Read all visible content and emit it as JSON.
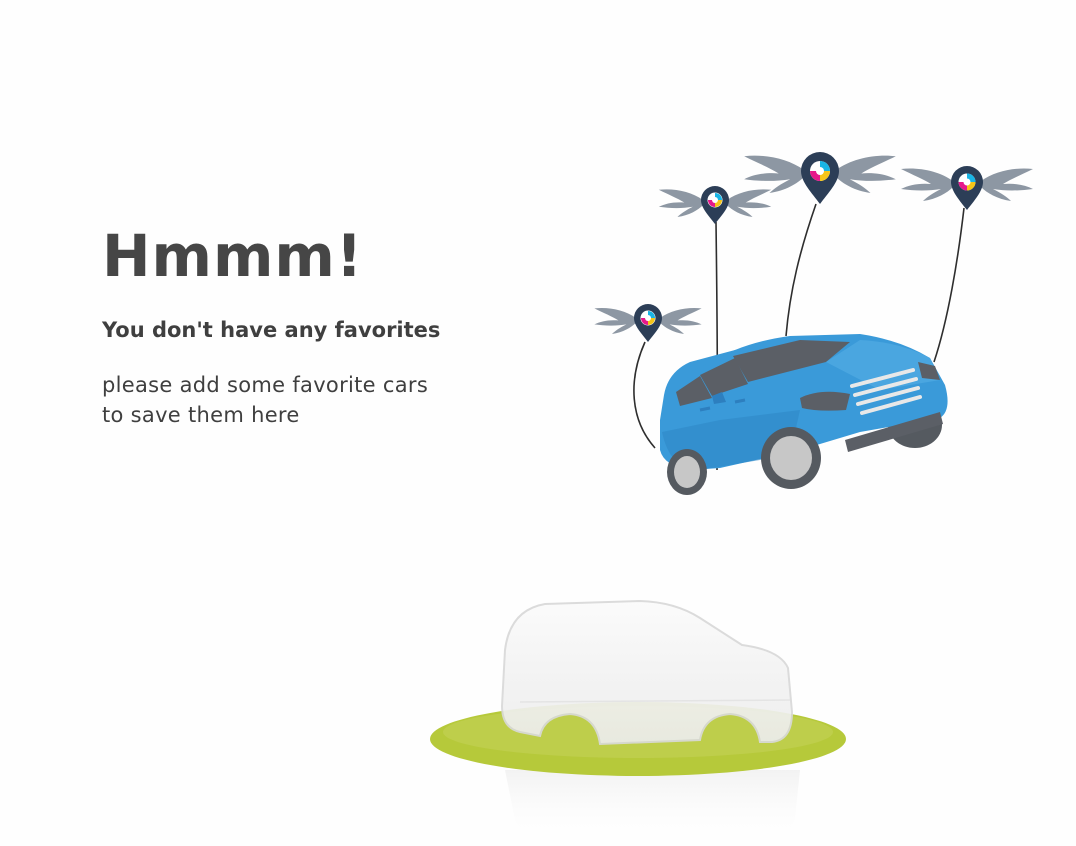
{
  "empty_state": {
    "title": "Hmmm!",
    "subtitle": "You don't have any favorites",
    "message_line1": "please add some favorite cars",
    "message_line2": "to save them here"
  },
  "colors": {
    "text_dark": "#464646",
    "text_body": "#3f3f3f",
    "car_blue": "#3a9ad9",
    "car_blue_dark": "#2d7fbf",
    "pin_navy": "#2c3e57",
    "wing_grey": "#8d97a3",
    "ground_green": "#b6c93a",
    "logo_pink": "#e6198b",
    "logo_yellow": "#f5c518",
    "logo_cyan": "#19b5e6"
  },
  "icons": {
    "flying_car": "flying-car-illustration",
    "winged_pin": "winged-location-pin-icon",
    "placeholder_car": "ghost-car-placeholder"
  }
}
